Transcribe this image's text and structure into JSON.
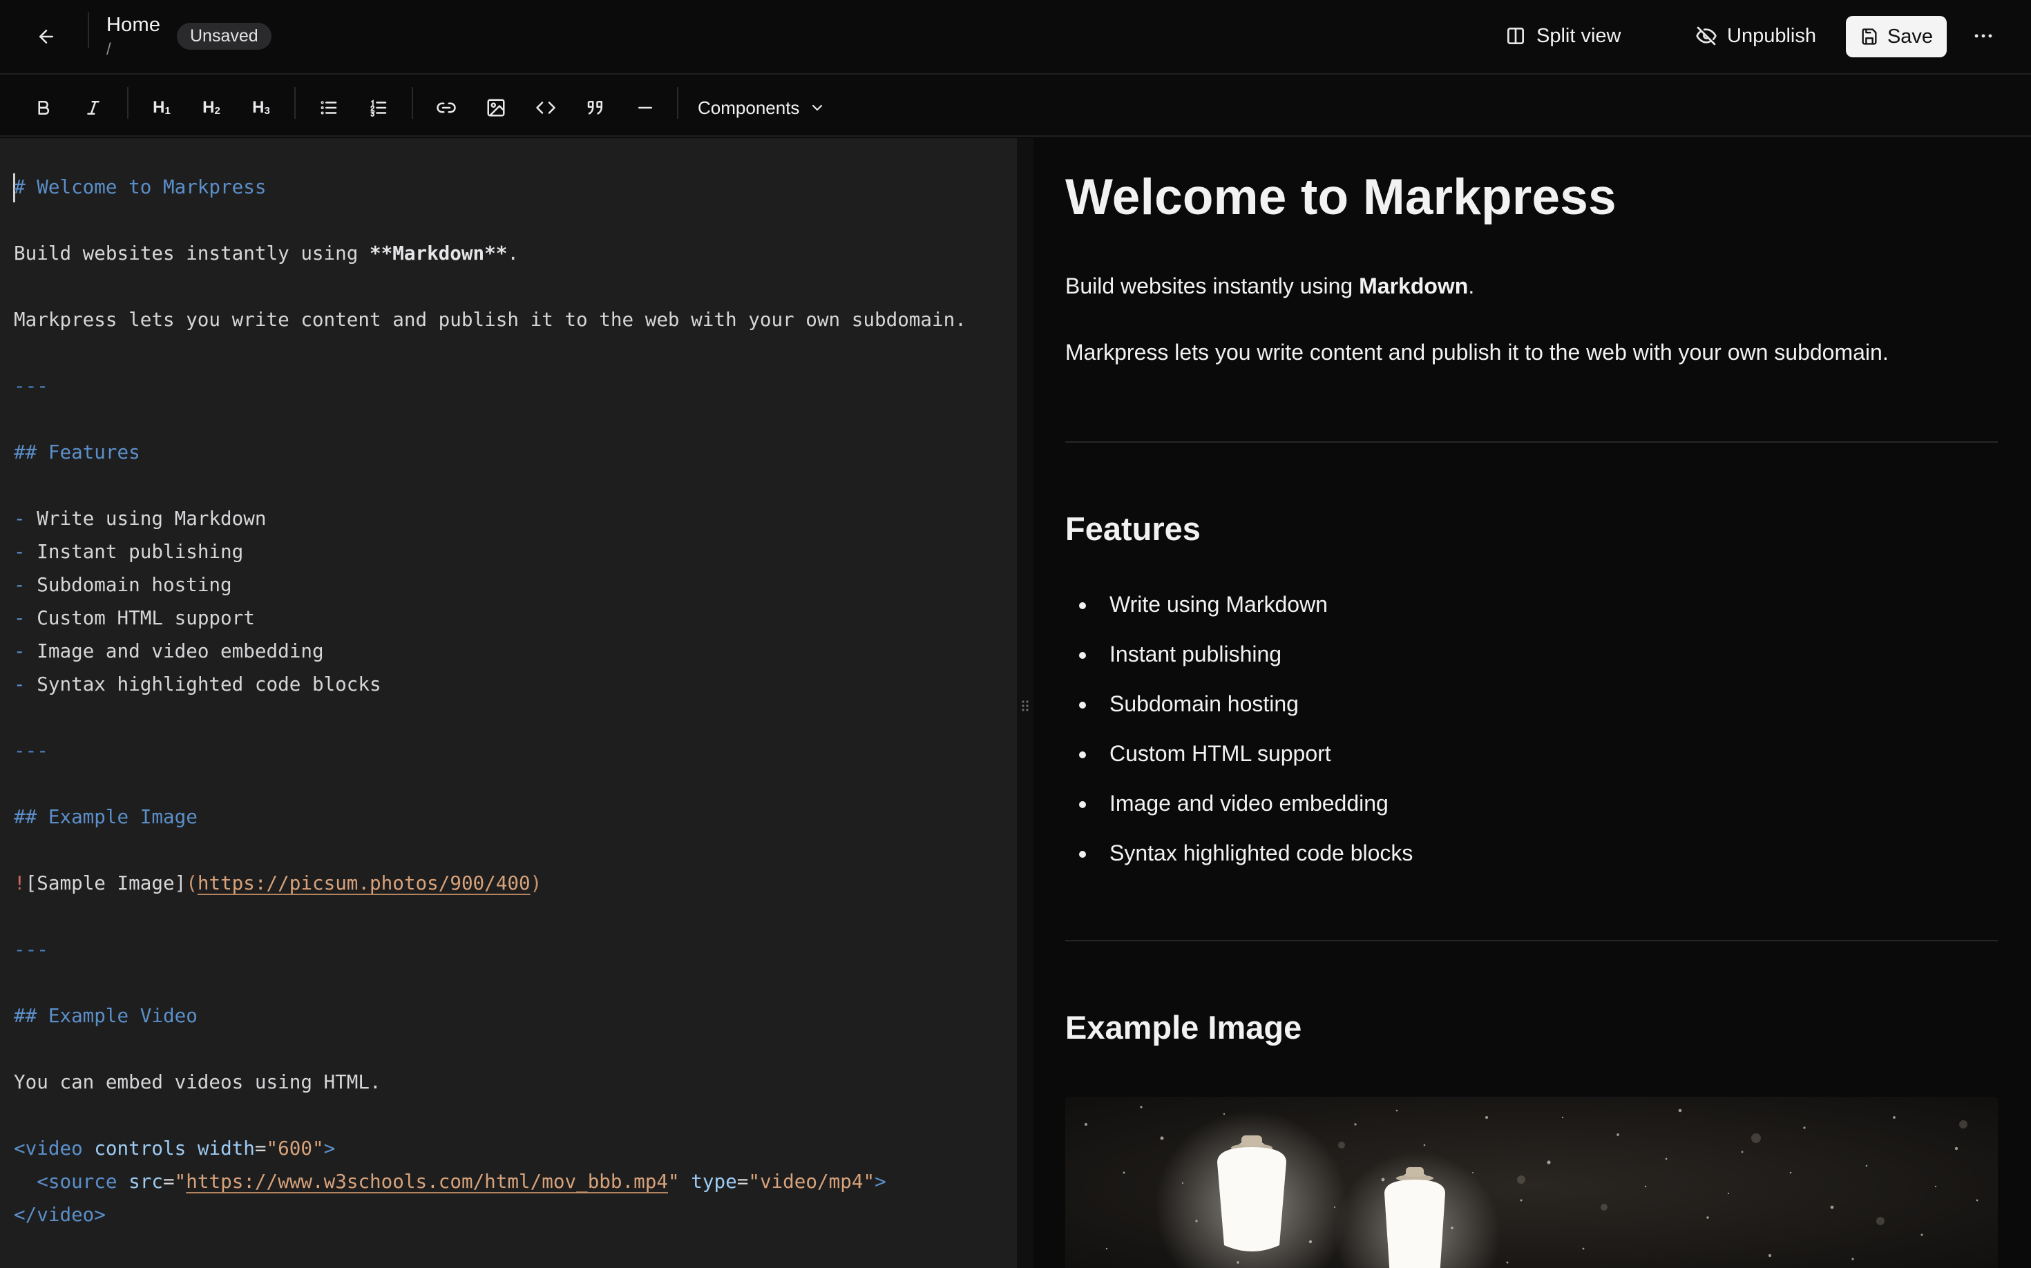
{
  "header": {
    "title": "Home",
    "path": "/",
    "status_badge": "Unsaved",
    "split_view_label": "Split view",
    "unpublish_label": "Unpublish",
    "save_label": "Save"
  },
  "toolbar": {
    "components_label": "Components",
    "h1": "H",
    "h2": "H",
    "h3": "H",
    "h1_num": "1",
    "h2_num": "2",
    "h3_num": "3",
    "icons": [
      "bold-icon",
      "italic-icon",
      "heading-1-icon",
      "heading-2-icon",
      "heading-3-icon",
      "bullet-list-icon",
      "ordered-list-icon",
      "link-icon",
      "image-icon",
      "code-icon",
      "quote-icon",
      "horizontal-rule-icon",
      "chevron-down-icon"
    ]
  },
  "editor": {
    "lines": {
      "h1": "# Welcome to Markpress",
      "p1_prefix": "Build websites instantly using ",
      "p1_bold": "**Markdown**",
      "p1_suffix": ".",
      "p2": "Markpress lets you write content and publish it to the web with your own subdomain.",
      "hr": "---",
      "h2_features": "## Features",
      "li_dash": "-",
      "li1": " Write using Markdown",
      "li2": " Instant publishing",
      "li3": " Subdomain hosting",
      "li4": " Custom HTML support",
      "li5": " Image and video embedding",
      "li6": " Syntax highlighted code blocks",
      "h2_image": "## Example Image",
      "img_bang": "!",
      "img_alt": "[Sample Image]",
      "img_open": "(",
      "img_url": "https://picsum.photos/900/400",
      "img_close": ")",
      "h2_video": "## Example Video",
      "video_text": "You can embed videos using HTML.",
      "video_open_tag": "<video",
      "video_attr_controls": "controls",
      "video_attr_width": "width",
      "video_eq": "=",
      "video_width_val": "\"600\"",
      "video_gt": ">",
      "source_open": "<source",
      "source_src": "src",
      "source_src_q1": "\"",
      "source_src_url": "https://www.w3schools.com/html/mov_bbb.mp4",
      "source_src_q2": "\"",
      "source_type": "type",
      "source_type_val": "\"video/mp4\"",
      "source_gt": ">",
      "video_close": "</video>"
    }
  },
  "preview": {
    "h1": "Welcome to Markpress",
    "p1_prefix": "Build websites instantly using ",
    "p1_bold": "Markdown",
    "p1_suffix": ".",
    "p2": "Markpress lets you write content and publish it to the web with your own subdomain.",
    "h2_features": "Features",
    "features": [
      "Write using Markdown",
      "Instant publishing",
      "Subdomain hosting",
      "Custom HTML support",
      "Image and video embedding",
      "Syntax highlighted code blocks"
    ],
    "h2_image": "Example Image"
  }
}
